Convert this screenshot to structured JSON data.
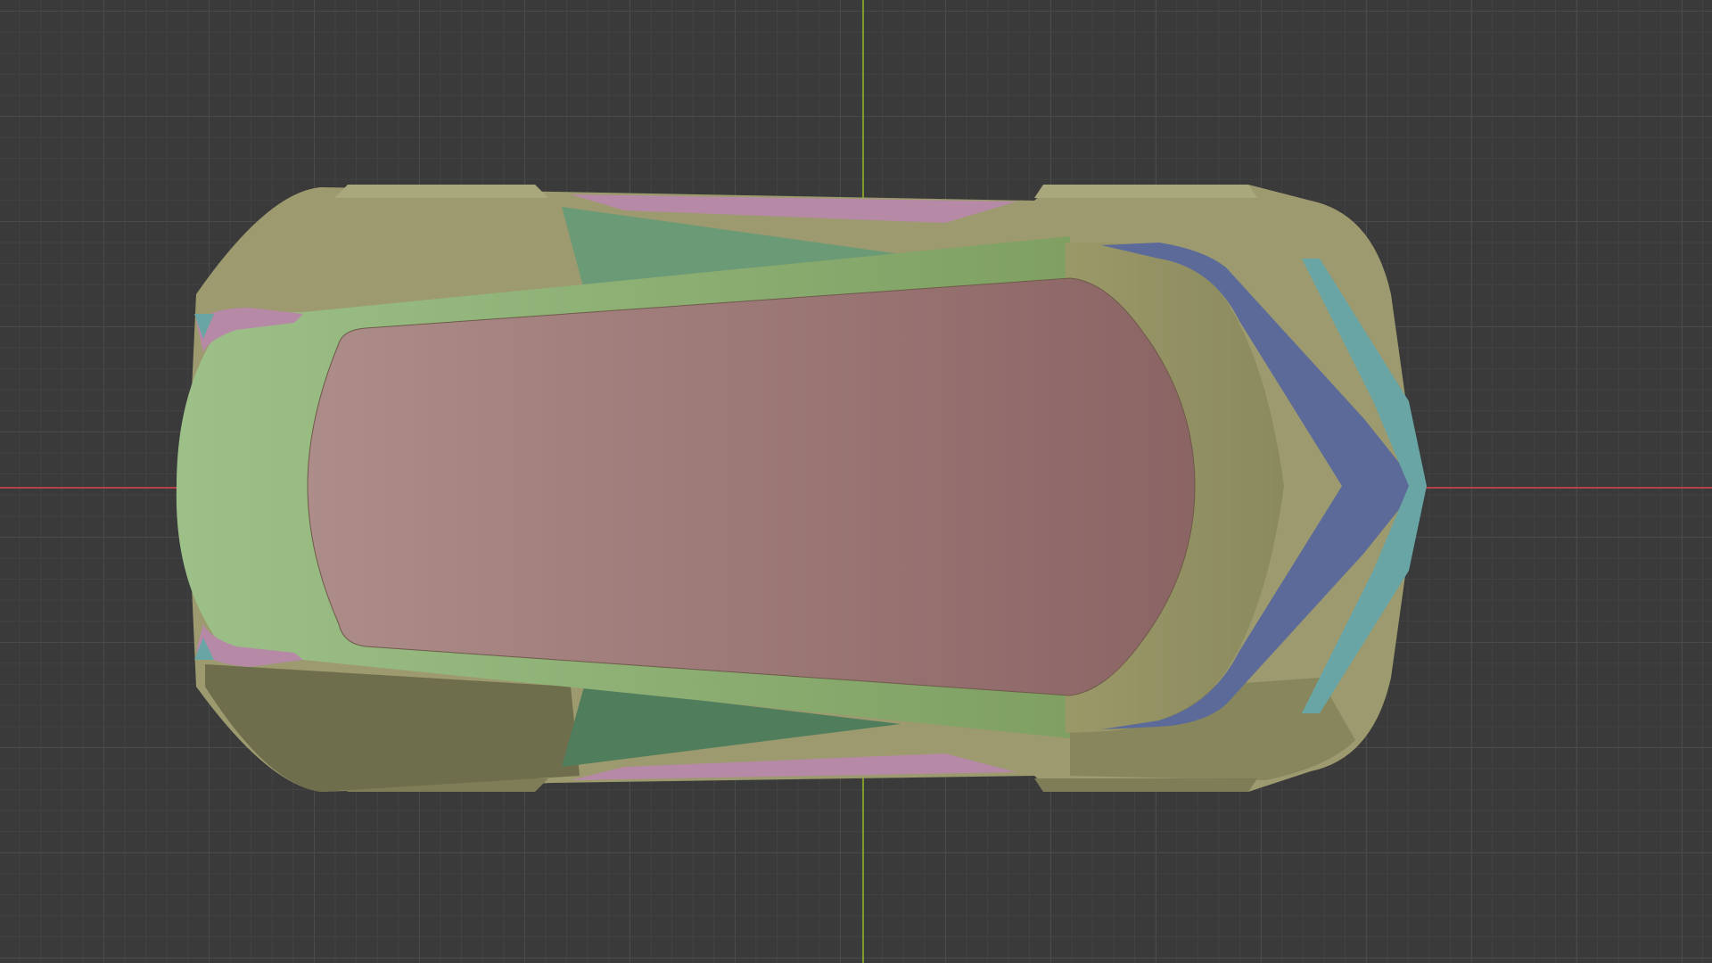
{
  "viewport": {
    "view": "top-orthographic",
    "grid": true,
    "axis_x_color": "#b4424a",
    "axis_y_color": "#7d9a2a",
    "background_color": "#3a3a3a"
  },
  "model": {
    "subject": "car-body-top-view",
    "colors": {
      "body": "#9a9a6c",
      "body_shadow": "#6e6e4a",
      "roof_frame": "#8db077",
      "glass": "#9a7070",
      "side_panel": "#6a9a78",
      "trim_pink": "#b388a6",
      "rear_blue": "#5c6a9a",
      "rear_teal": "#6aa5a5"
    }
  }
}
